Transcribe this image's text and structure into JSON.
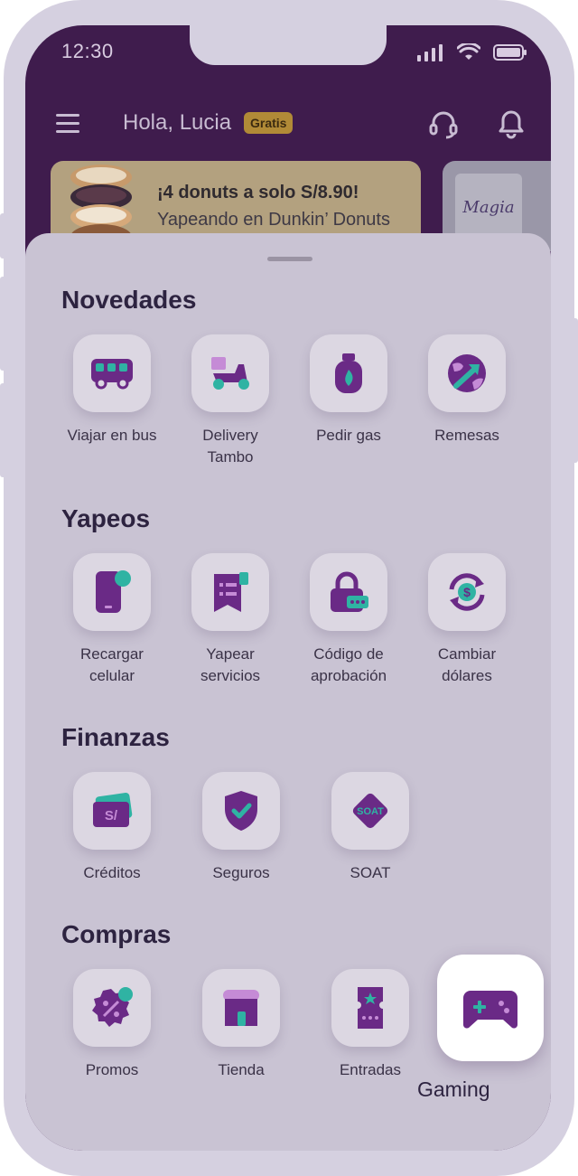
{
  "status": {
    "time": "12:30"
  },
  "header": {
    "greeting": "Hola, Lucia",
    "badge": "Gratis"
  },
  "banner": {
    "title": "¡4 donuts a solo S/8.90!",
    "subtitle": "Yapeando en Dunkin’ Donuts",
    "secondary_logo": "Magia"
  },
  "sections": {
    "novedades": {
      "title": "Novedades",
      "items": [
        {
          "label": "Viajar en bus",
          "icon": "bus-icon"
        },
        {
          "label": "Delivery Tambo",
          "icon": "scooter-icon"
        },
        {
          "label": "Pedir gas",
          "icon": "gas-tank-icon"
        },
        {
          "label": "Remesas",
          "icon": "globe-icon"
        }
      ]
    },
    "yapeos": {
      "title": "Yapeos",
      "items": [
        {
          "label": "Recargar celular",
          "icon": "phone-icon"
        },
        {
          "label": "Yapear servicios",
          "icon": "receipt-icon"
        },
        {
          "label": "Código de aprobación",
          "icon": "lock-code-icon"
        },
        {
          "label": "Cambiar dólares",
          "icon": "currency-exchange-icon"
        }
      ]
    },
    "finanzas": {
      "title": "Finanzas",
      "items": [
        {
          "label": "Créditos",
          "icon": "money-card-icon"
        },
        {
          "label": "Seguros",
          "icon": "shield-check-icon"
        },
        {
          "label": "SOAT",
          "icon": "soat-icon"
        }
      ]
    },
    "compras": {
      "title": "Compras",
      "items": [
        {
          "label": "Promos",
          "icon": "discount-badge-icon"
        },
        {
          "label": "Tienda",
          "icon": "store-icon"
        },
        {
          "label": "Entradas",
          "icon": "ticket-icon"
        },
        {
          "label": "Gaming",
          "icon": "gamepad-icon"
        }
      ]
    }
  },
  "soat_text": "SOAT",
  "credit_symbol": "S/",
  "dollar_symbol": "$",
  "colors": {
    "purple": "#6a2a86",
    "teal": "#2fb3a3",
    "sheet": "#c9c3d3",
    "frame": "#d5d0e0"
  }
}
